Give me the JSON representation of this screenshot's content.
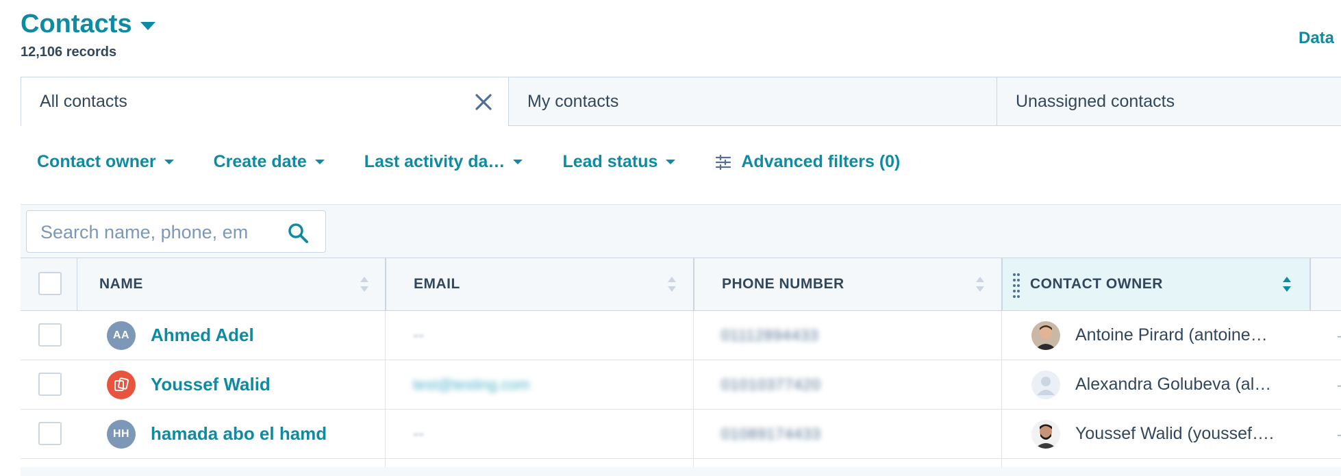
{
  "header": {
    "title": "Contacts",
    "record_count": "12,106 records",
    "top_right_link": "Data"
  },
  "tabs": [
    {
      "label": "All contacts",
      "active": true,
      "closable": true
    },
    {
      "label": "My contacts",
      "active": false
    },
    {
      "label": "Unassigned contacts",
      "active": false
    }
  ],
  "filters": {
    "contact_owner": "Contact owner",
    "create_date": "Create date",
    "last_activity": "Last activity da…",
    "lead_status": "Lead status",
    "advanced": "Advanced filters (0)"
  },
  "search": {
    "placeholder": "Search name, phone, em",
    "value": ""
  },
  "table": {
    "columns": {
      "name": "NAME",
      "email": "EMAIL",
      "phone": "PHONE NUMBER",
      "owner": "CONTACT OWNER"
    },
    "rows": [
      {
        "initials": "AA",
        "name": "Ahmed Adel",
        "email": "--",
        "phone": "01112894433",
        "owner": "Antoine Pirard (antoine…"
      },
      {
        "initials": "",
        "name": "Youssef Walid",
        "email": "test@testing.com",
        "phone": "01010377420",
        "owner": "Alexandra Golubeva (al…"
      },
      {
        "initials": "HH",
        "name": "hamada abo el hamd",
        "email": "--",
        "phone": "01089174433",
        "owner": "Youssef Walid (youssef…."
      }
    ]
  },
  "colors": {
    "accent": "#0e8ba3",
    "text": "#33475b",
    "avatar_gray": "#7c98b6",
    "avatar_orange": "#e8553e",
    "header_highlight": "#e5f5f8"
  }
}
